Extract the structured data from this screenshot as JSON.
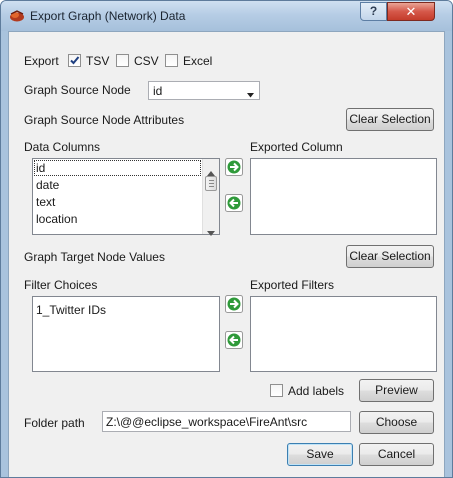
{
  "window": {
    "title": "Export Graph (Network) Data",
    "help_label": "?",
    "close_label": "✕"
  },
  "export": {
    "label": "Export",
    "options": [
      {
        "label": "TSV",
        "checked": true
      },
      {
        "label": "CSV",
        "checked": false
      },
      {
        "label": "Excel",
        "checked": false
      }
    ]
  },
  "source_node": {
    "label": "Graph Source Node",
    "selected": "id"
  },
  "source_attributes": {
    "label": "Graph Source Node Attributes",
    "clear_label": "Clear Selection"
  },
  "data_columns": {
    "label": "Data Columns",
    "items": [
      "id",
      "date",
      "text",
      "location"
    ],
    "selected_index": 0
  },
  "exported_column": {
    "label": "Exported Column",
    "items": []
  },
  "target_values": {
    "label": "Graph Target Node Values",
    "clear_label": "Clear Selection"
  },
  "filter_choices": {
    "label": "Filter Choices",
    "items": [
      "1_Twitter IDs"
    ]
  },
  "exported_filters": {
    "label": "Exported Filters",
    "items": []
  },
  "add_labels": {
    "label": "Add labels",
    "checked": false
  },
  "preview_label": "Preview",
  "folder": {
    "label": "Folder path",
    "value": "Z:\\@@eclipse_workspace\\FireAnt\\src",
    "choose_label": "Choose"
  },
  "save_label": "Save",
  "cancel_label": "Cancel",
  "colors": {
    "title_bar": "#b6cde5",
    "close_button": "#c43c2b",
    "move_arrow": "#3aa53a",
    "dialog_bg": "#f0f0f0"
  }
}
